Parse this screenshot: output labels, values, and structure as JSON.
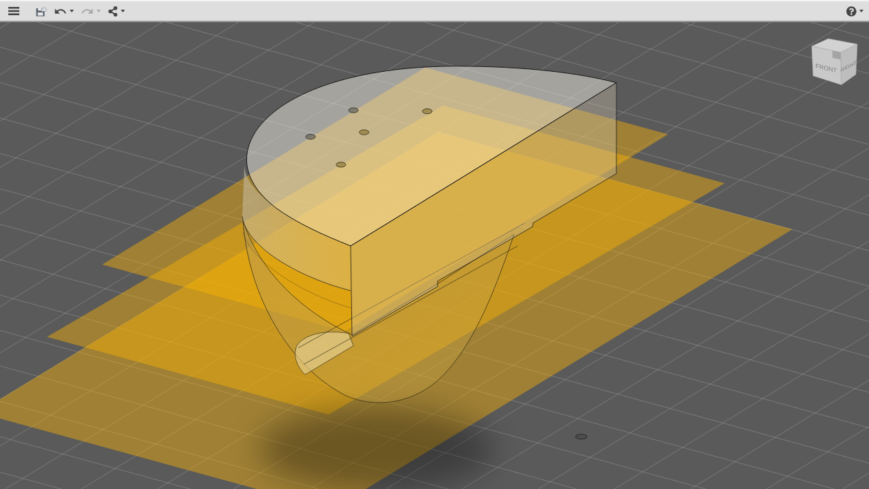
{
  "toolbar": {
    "menu": {
      "kind": "menu",
      "disabled": false,
      "dropdown": false
    },
    "tools": [
      {
        "kind": "save",
        "disabled": false,
        "dropdown": false
      },
      {
        "kind": "undo",
        "disabled": false,
        "dropdown": true
      },
      {
        "kind": "redo",
        "disabled": true,
        "dropdown": true
      },
      {
        "kind": "share",
        "disabled": false,
        "dropdown": true
      }
    ],
    "help": {
      "kind": "help",
      "disabled": false,
      "dropdown": true
    }
  },
  "viewport": {
    "view_cube": {
      "front_label": "FRONT",
      "right_label": "RIGHT"
    }
  }
}
